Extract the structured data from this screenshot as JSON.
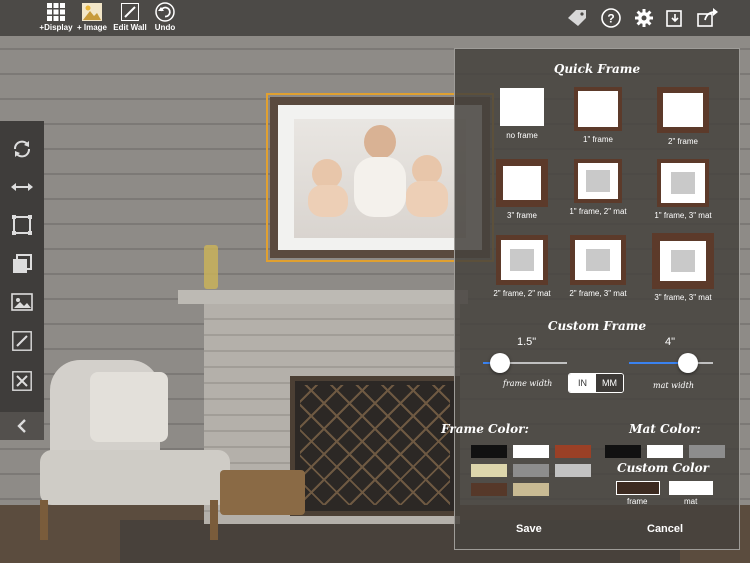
{
  "toolbar": {
    "display_label": "+Display",
    "image_label": "+ Image",
    "edit_wall_label": "Edit Wall",
    "undo_label": "Undo"
  },
  "panel": {
    "quick_frame_title": "Quick Frame",
    "quick_frames": [
      "no frame",
      "1\" frame",
      "2\" frame",
      "3\" frame",
      "1\" frame, 2\" mat",
      "1\" frame, 3\" mat",
      "2\" frame, 2\" mat",
      "2\" frame, 3\" mat",
      "3\" frame, 3\" mat"
    ],
    "custom_frame_title": "Custom Frame",
    "frame_width_value": "1.5\"",
    "frame_width_label": "frame width",
    "frame_width_level": 0.2,
    "mat_width_value": "4\"",
    "mat_width_label": "mat width",
    "mat_width_level": 0.7,
    "unit_in": "IN",
    "unit_mm": "MM",
    "selected_unit": "IN",
    "frame_color_title": "Frame Color:",
    "mat_color_title": "Mat Color:",
    "custom_color_title": "Custom Color",
    "custom_frame_label": "frame",
    "custom_mat_label": "mat",
    "save_label": "Save",
    "cancel_label": "Cancel",
    "frame_colors": [
      "#111111",
      "#ffffff",
      "#9a4026",
      "#ddd6ac",
      "#8d8d8d",
      "#c2c2c2",
      "#563829",
      "#c8ba93"
    ],
    "mat_colors": [
      "#111111",
      "#ffffff",
      "#8d8d8d"
    ],
    "custom_frame_color": "#3c2a20",
    "custom_mat_color": "#ffffff"
  },
  "colors": {
    "frame_brown": "#5c3a2a",
    "selection_orange": "#e0a030",
    "slider_blue": "#3a82f0"
  }
}
